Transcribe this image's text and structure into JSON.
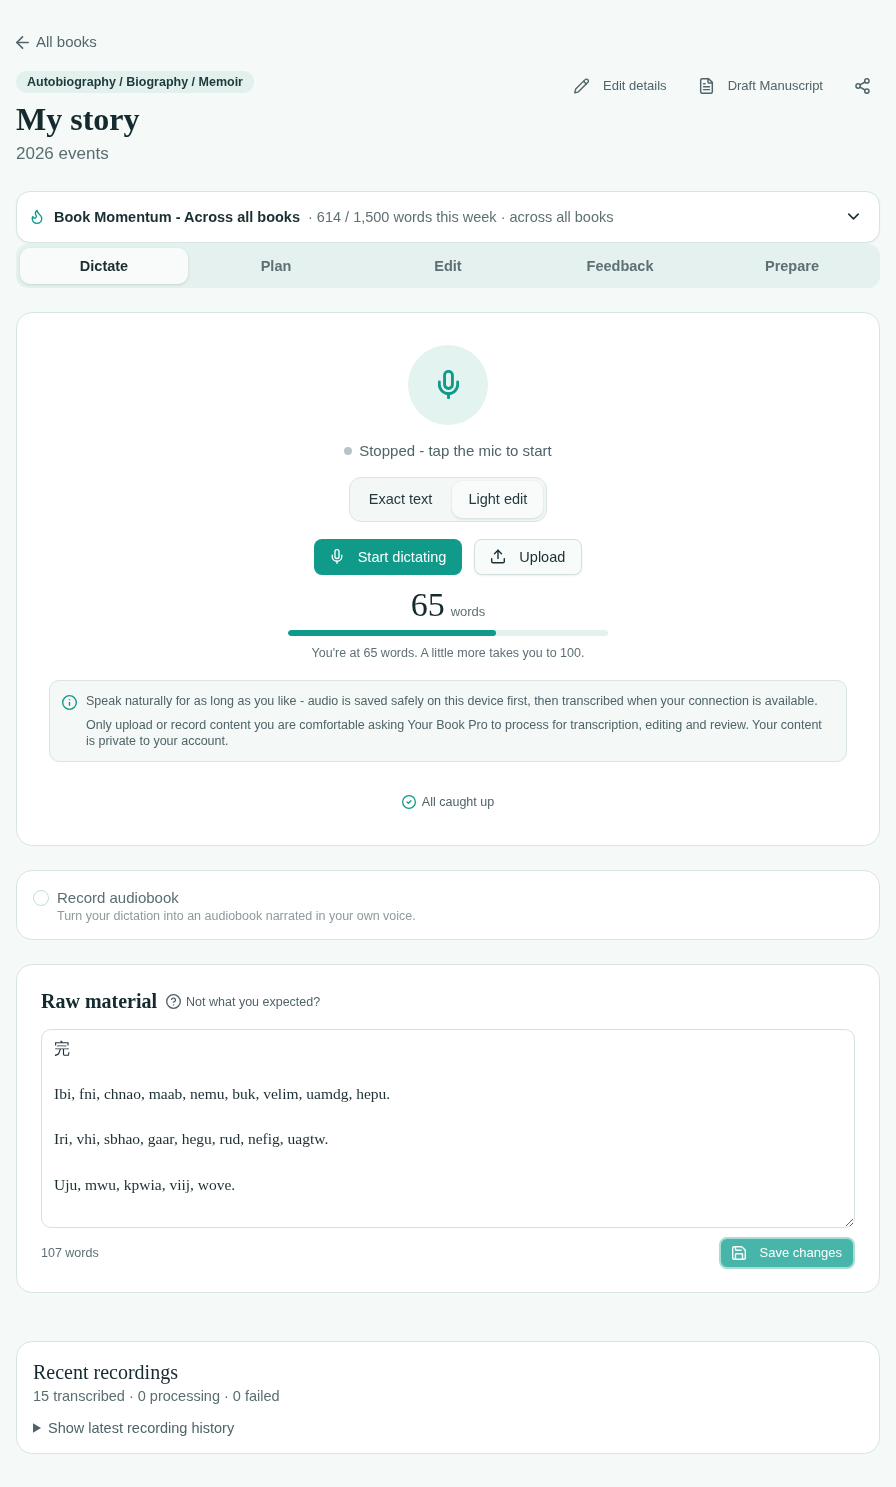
{
  "back_link": {
    "label": "All books"
  },
  "header": {
    "genre_tag": "Autobiography / Biography / Memoir",
    "title": "My story",
    "subtitle": "2026 events",
    "actions": [
      {
        "kind": "edit",
        "label": "Edit details"
      },
      {
        "kind": "document",
        "label": "Draft Manuscript"
      },
      {
        "kind": "share"
      }
    ]
  },
  "momentum": {
    "title": "Book Momentum - Across all books",
    "summary": "· 614 / 1,500 words this week · across all books",
    "expanded": false
  },
  "tabs": [
    {
      "label": "Dictate",
      "selected": true
    },
    {
      "label": "Plan",
      "selected": false
    },
    {
      "label": "Edit",
      "selected": false
    },
    {
      "label": "Feedback",
      "selected": false
    },
    {
      "label": "Prepare",
      "selected": false
    }
  ],
  "dictation": {
    "recording": false,
    "status": "Stopped - tap the mic to start",
    "modes": [
      {
        "label": "Exact text",
        "selected": false
      },
      {
        "label": "Light edit",
        "selected": true
      }
    ],
    "buttons": [
      {
        "kind": "dictate",
        "label": "Start dictating"
      },
      {
        "kind": "upload",
        "label": "Upload"
      }
    ],
    "word_count": "65",
    "word_unit": "words",
    "progress": {
      "level": 0.65,
      "note": "You're at 65 words. A little more takes you to 100."
    },
    "info": [
      "Speak naturally for as long as you like - audio is saved safely on this device first, then transcribed when your connection is available.",
      "Only upload or record content you are comfortable asking Your Book Pro to process for transcription, editing and review. Your content is private to your account."
    ],
    "sync_status": "All caught up"
  },
  "audiobook": {
    "checked": false,
    "title": "Record audiobook",
    "description": "Turn your dictation into an audiobook narrated in your own voice."
  },
  "raw_material": {
    "title": "Raw material",
    "help_link": "Not what you expected?",
    "text": "完\n\nIbi, fni, chnao, maab, nemu, buk, velim, uamdg, hepu.\n\nIri, vhi, sbhao, gaar, hegu, rud, nefig, uagtw.\n\nUju, mwu, kpwia, viij, wove.",
    "word_count": "107 words",
    "save_button": "Save changes"
  },
  "recent_recordings": {
    "title": "Recent recordings",
    "summary": "15 transcribed · 0 processing · 0 failed",
    "history_toggle": {
      "label": "Show latest recording history",
      "expanded": false
    }
  }
}
